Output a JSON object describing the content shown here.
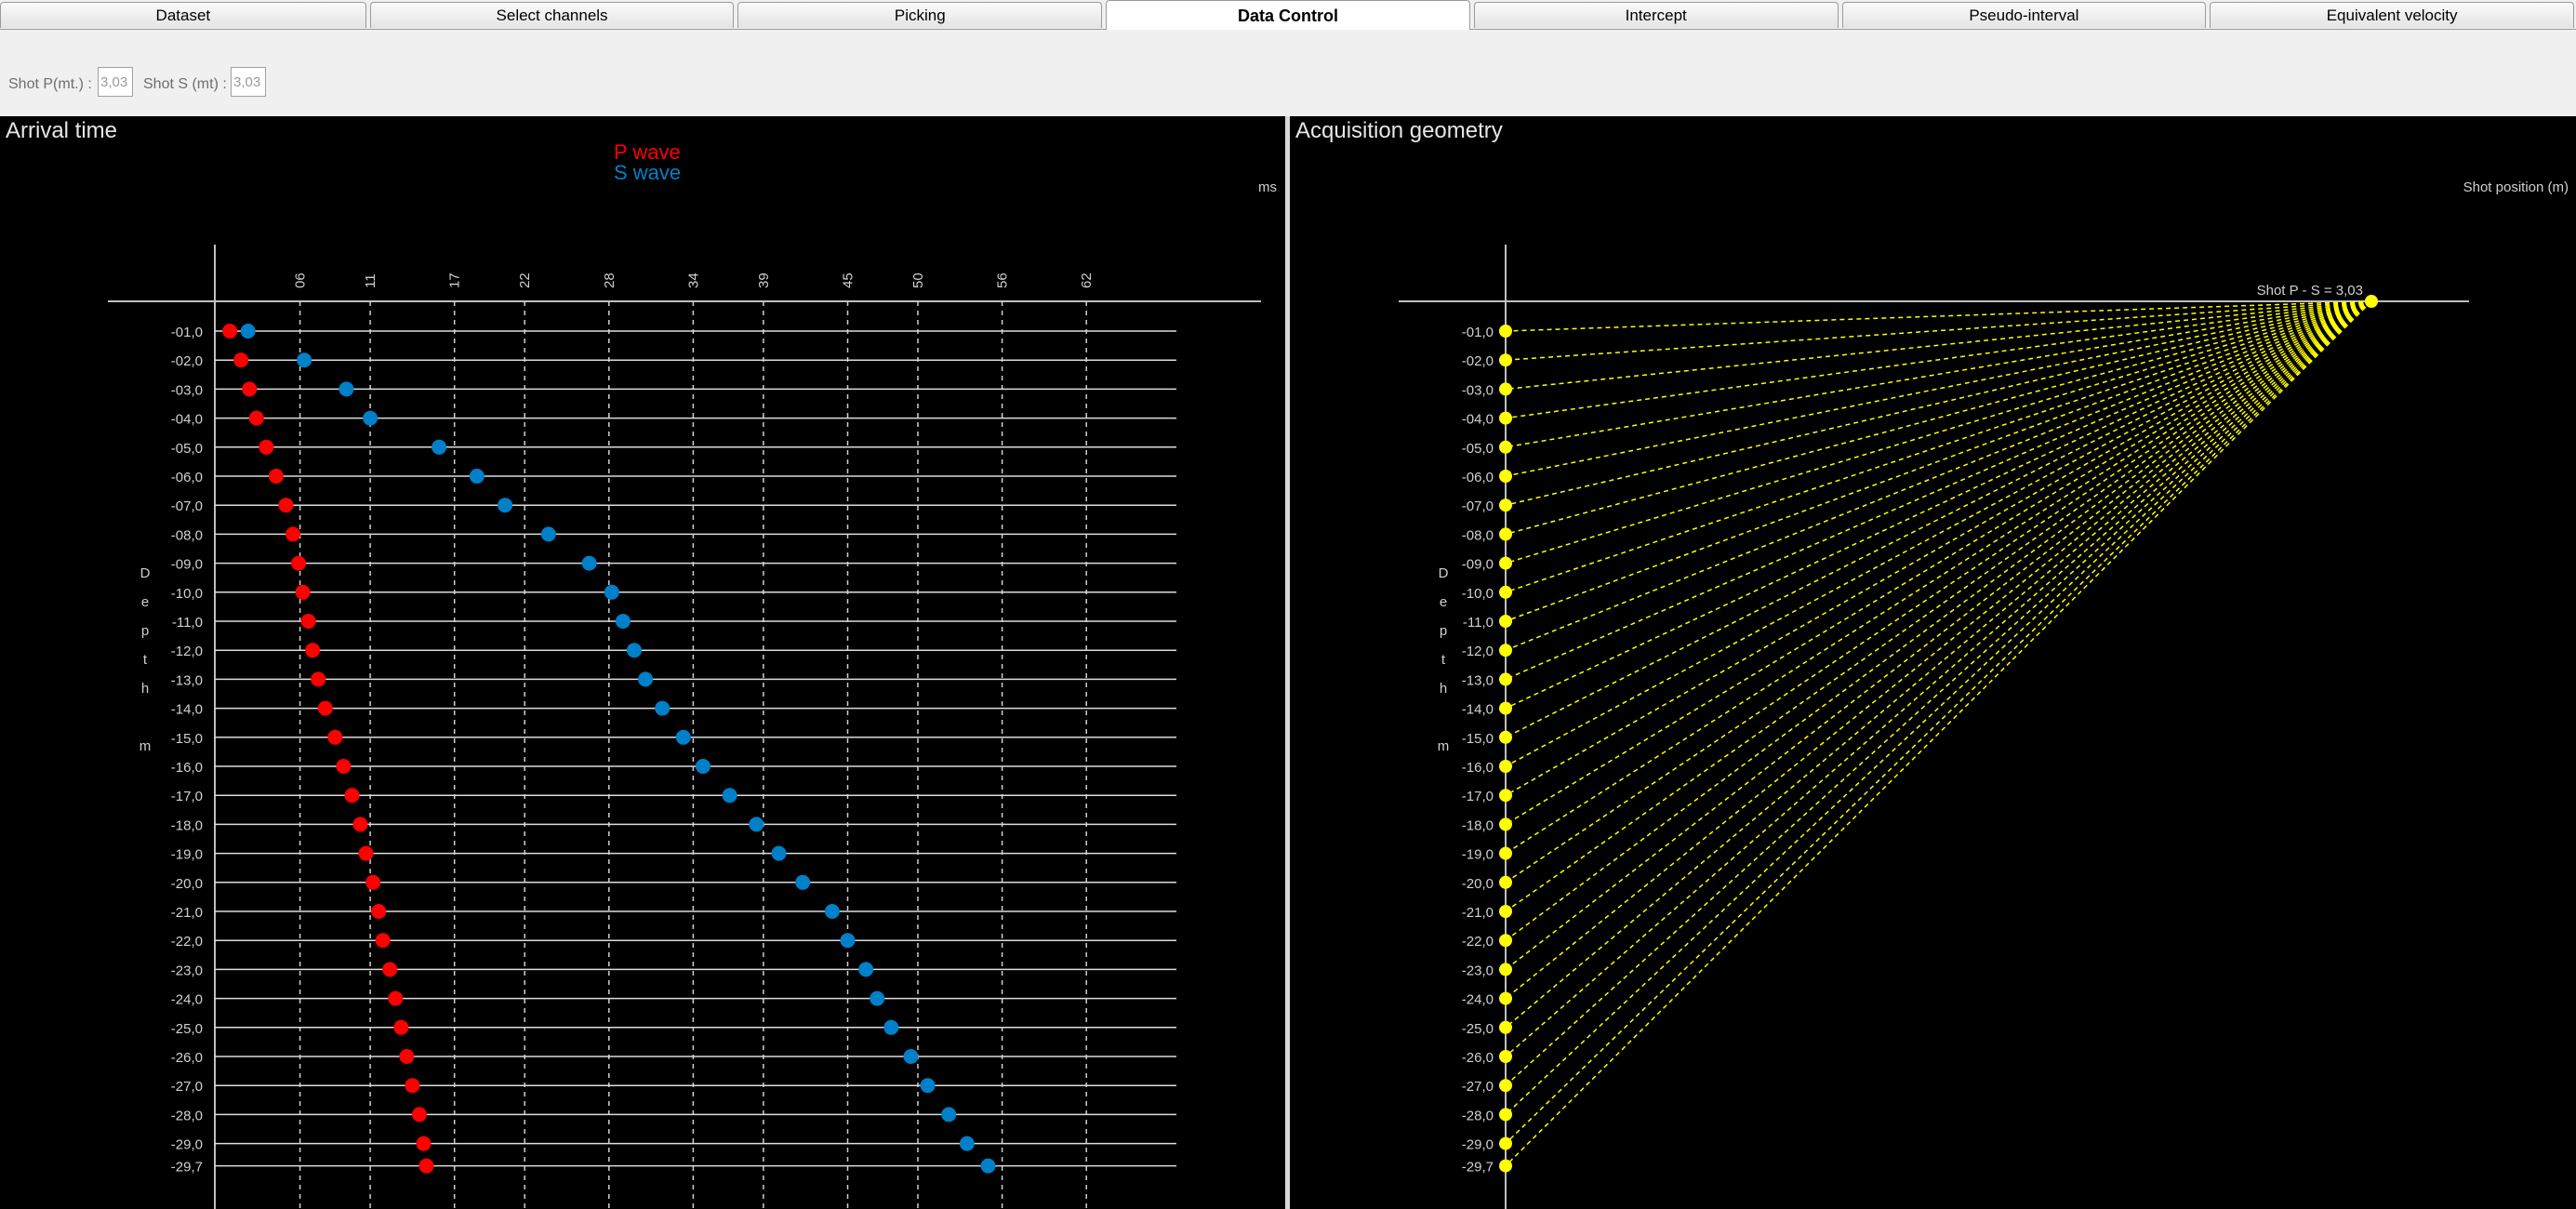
{
  "tabs": [
    {
      "label": "Dataset",
      "active": false
    },
    {
      "label": "Select channels",
      "active": false
    },
    {
      "label": "Picking",
      "active": false
    },
    {
      "label": "Data Control",
      "active": true
    },
    {
      "label": "Intercept",
      "active": false
    },
    {
      "label": "Pseudo-interval",
      "active": false
    },
    {
      "label": "Equivalent velocity",
      "active": false
    }
  ],
  "controls": {
    "shot_p_label": "Shot P(mt.) :",
    "shot_p_value": "3,03",
    "shot_s_label": "Shot S (mt) :",
    "shot_s_value": "3,03"
  },
  "colors": {
    "p_wave": "#ff0000",
    "s_wave": "#0080c8",
    "geometry": "#ffff00"
  },
  "chart_data": [
    {
      "type": "scatter",
      "title": "Arrival time",
      "x_unit": "ms",
      "ylabel": "Depth m",
      "legend": [
        "P wave",
        "S wave"
      ],
      "legend_position": "top-center",
      "x_ticks": [
        "06",
        "11",
        "17",
        "22",
        "28",
        "34",
        "39",
        "45",
        "50",
        "56",
        "62"
      ],
      "xlim": [
        0,
        62
      ],
      "y_ticks": [
        "-01,0",
        "-02,0",
        "-03,0",
        "-04,0",
        "-05,0",
        "-06,0",
        "-07,0",
        "-08,0",
        "-09,0",
        "-10,0",
        "-11,0",
        "-12,0",
        "-13,0",
        "-14,0",
        "-15,0",
        "-16,0",
        "-17,0",
        "-18,0",
        "-19,0",
        "-20,0",
        "-21,0",
        "-22,0",
        "-23,0",
        "-24,0",
        "-25,0",
        "-26,0",
        "-27,0",
        "-28,0",
        "-29,0",
        "-29,7"
      ],
      "depth": [
        -1,
        -2,
        -3,
        -4,
        -5,
        -6,
        -7,
        -8,
        -9,
        -10,
        -11,
        -12,
        -13,
        -14,
        -15,
        -16,
        -17,
        -18,
        -19,
        -20,
        -21,
        -22,
        -23,
        -24,
        -25,
        -26,
        -27,
        -28,
        -29,
        -29.7
      ],
      "grid": true,
      "series": [
        {
          "name": "P wave",
          "values": [
            1.0,
            1.8,
            2.4,
            2.9,
            3.6,
            4.3,
            5.0,
            5.5,
            5.9,
            6.2,
            6.6,
            6.9,
            7.3,
            7.8,
            8.5,
            9.1,
            9.7,
            10.3,
            10.7,
            11.2,
            11.6,
            11.9,
            12.4,
            12.8,
            13.2,
            13.6,
            14.0,
            14.5,
            14.8,
            15.0
          ]
        },
        {
          "name": "S wave",
          "values": [
            2.3,
            6.3,
            9.3,
            11.0,
            15.9,
            18.6,
            20.6,
            23.7,
            26.6,
            28.2,
            29.0,
            29.8,
            30.6,
            31.8,
            33.3,
            34.7,
            36.6,
            38.5,
            40.1,
            41.8,
            43.9,
            45.0,
            46.3,
            47.1,
            48.1,
            49.5,
            50.7,
            52.2,
            53.5,
            55.0
          ]
        }
      ]
    },
    {
      "type": "diagram",
      "title": "Acquisition geometry",
      "x_unit": "Shot position (m)",
      "ylabel": "Depth m",
      "shot_label": "Shot P - S = 3,03",
      "shot_position": 3.03,
      "y_ticks": [
        "-01,0",
        "-02,0",
        "-03,0",
        "-04,0",
        "-05,0",
        "-06,0",
        "-07,0",
        "-08,0",
        "-09,0",
        "-10,0",
        "-11,0",
        "-12,0",
        "-13,0",
        "-14,0",
        "-15,0",
        "-16,0",
        "-17,0",
        "-18,0",
        "-19,0",
        "-20,0",
        "-21,0",
        "-22,0",
        "-23,0",
        "-24,0",
        "-25,0",
        "-26,0",
        "-27,0",
        "-28,0",
        "-29,0",
        "-29,7"
      ],
      "receiver_depths": [
        -1,
        -2,
        -3,
        -4,
        -5,
        -6,
        -7,
        -8,
        -9,
        -10,
        -11,
        -12,
        -13,
        -14,
        -15,
        -16,
        -17,
        -18,
        -19,
        -20,
        -21,
        -22,
        -23,
        -24,
        -25,
        -26,
        -27,
        -28,
        -29,
        -29.7
      ]
    }
  ]
}
